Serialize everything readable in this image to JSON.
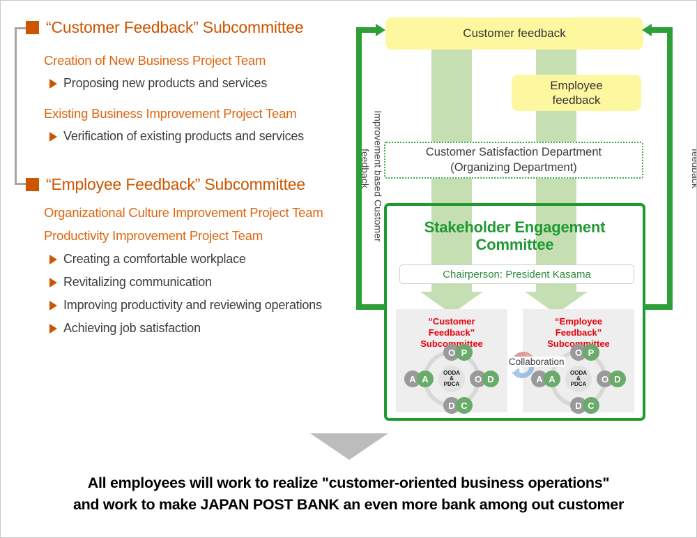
{
  "left_panel": {
    "sections": [
      {
        "marker": "square-marker",
        "heading": "“Customer Feedback” Subcommittee",
        "teams": [
          {
            "name": "Creation of New Business Project Team",
            "bullets": [
              "Proposing new products and services"
            ]
          },
          {
            "name": "Existing Business Improvement Project Team",
            "bullets": [
              "Verification of existing products and services"
            ]
          }
        ]
      },
      {
        "marker": "square-marker",
        "heading": "“Employee Feedback” Subcommittee",
        "teams": [
          {
            "name": "Organizational Culture Improvement Project Team",
            "bullets": []
          },
          {
            "name": "Productivity Improvement Project Team",
            "bullets": []
          }
        ],
        "bullets": [
          "Creating a comfortable workplace",
          "Revitalizing communication",
          "Improving productivity and reviewing operations",
          "Achieving job satisfaction"
        ]
      }
    ]
  },
  "diagram": {
    "customer_feedback_box": "Customer feedback",
    "employee_feedback_box": "Employee\nfeedback",
    "department_box": "Customer Satisfaction Department\n(Organizing Department)",
    "committee_title": "Stakeholder Engagement\nCommittee",
    "chairperson": "Chairperson: President Kasama",
    "subcommittees": [
      {
        "title": "“Customer\nFeedback”\nSubcommittee",
        "cycle": {
          "center": "OODA\n&\nPDCA",
          "outer": [
            "O",
            "O",
            "D",
            "A"
          ],
          "inner": [
            "P",
            "D",
            "C",
            "A"
          ]
        }
      },
      {
        "title": "“Employee\nFeedback”\nSubcommittee",
        "cycle": {
          "center": "OODA\n&\nPDCA",
          "outer": [
            "O",
            "O",
            "D",
            "A"
          ],
          "inner": [
            "P",
            "D",
            "C",
            "A"
          ]
        }
      }
    ],
    "collaboration_label": "Collaboration",
    "left_flow_label": "Improvement based Customer\nfeedback",
    "right_flow_label": "Improvement based Employee\nfeedback"
  },
  "footer": {
    "line1": "All employees will work to realize \"customer-oriented business operations\"",
    "line2": "and work to make JAPAN POST BANK an even more bank among out customer"
  },
  "colors": {
    "orange": "#cc5500",
    "green": "#1f9a32",
    "pipe_green": "#2e9e37",
    "band_green": "#c5dfb3",
    "yellow": "#fdf8a0",
    "red": "#e8000d",
    "gray_box": "#eeeeee",
    "bracket_gray": "#a6a6a6"
  }
}
